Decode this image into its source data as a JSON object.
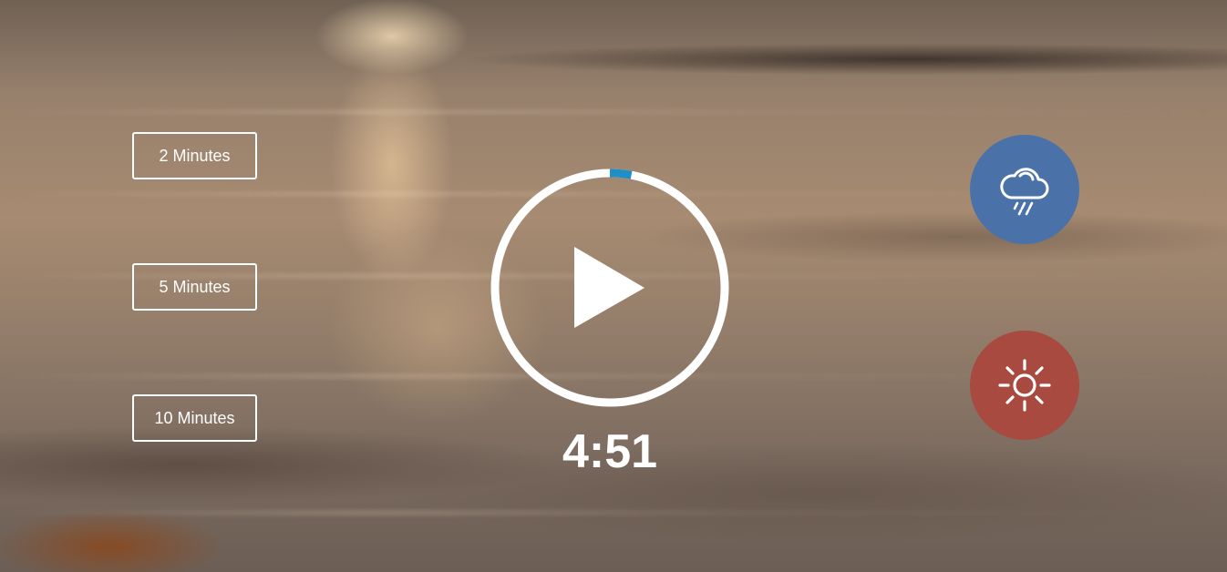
{
  "durations": [
    {
      "label": "2 Minutes"
    },
    {
      "label": "5 Minutes"
    },
    {
      "label": "10 Minutes"
    }
  ],
  "player": {
    "icon": "play-icon",
    "progress_fraction": 0.03,
    "ring_color": "#ffffff",
    "progress_color": "#1f8fc6"
  },
  "timer": {
    "remaining": "4:51"
  },
  "sounds": [
    {
      "name": "rain",
      "icon": "cloud-rain-icon",
      "color": "#4a72a8"
    },
    {
      "name": "sun",
      "icon": "sun-icon",
      "color": "#a84a40"
    }
  ]
}
